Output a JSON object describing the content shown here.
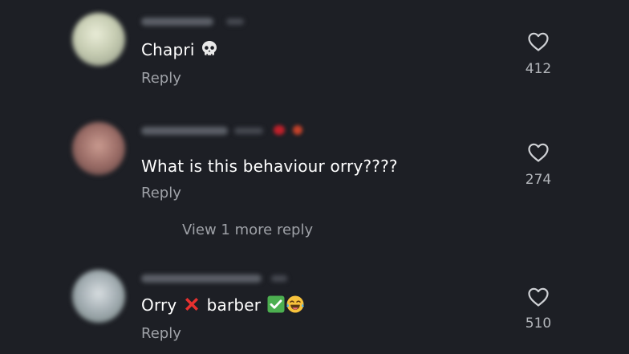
{
  "comments": [
    {
      "text": "Chapri",
      "emoji_1": "💀",
      "reply_label": "Reply",
      "likes": "412"
    },
    {
      "text": "What is this behaviour orry????",
      "reply_label": "Reply",
      "likes": "274",
      "view_more_label": "View 1 more reply"
    },
    {
      "text_part_1": "Orry",
      "emoji_1": "❌",
      "text_part_2": "barber",
      "emoji_2": "✅",
      "emoji_3": "😂",
      "reply_label": "Reply",
      "likes": "510"
    }
  ],
  "icons": {
    "like": "heart-outline-icon",
    "skull": "skull-emoji",
    "cross": "cross-mark-emoji",
    "check": "check-mark-emoji",
    "laugh": "face-with-tears-of-joy-emoji"
  },
  "colors": {
    "background": "#1d1f25",
    "text": "#ffffff",
    "secondary_text": "#9ea1a7",
    "like_count": "#b3b6bb"
  }
}
